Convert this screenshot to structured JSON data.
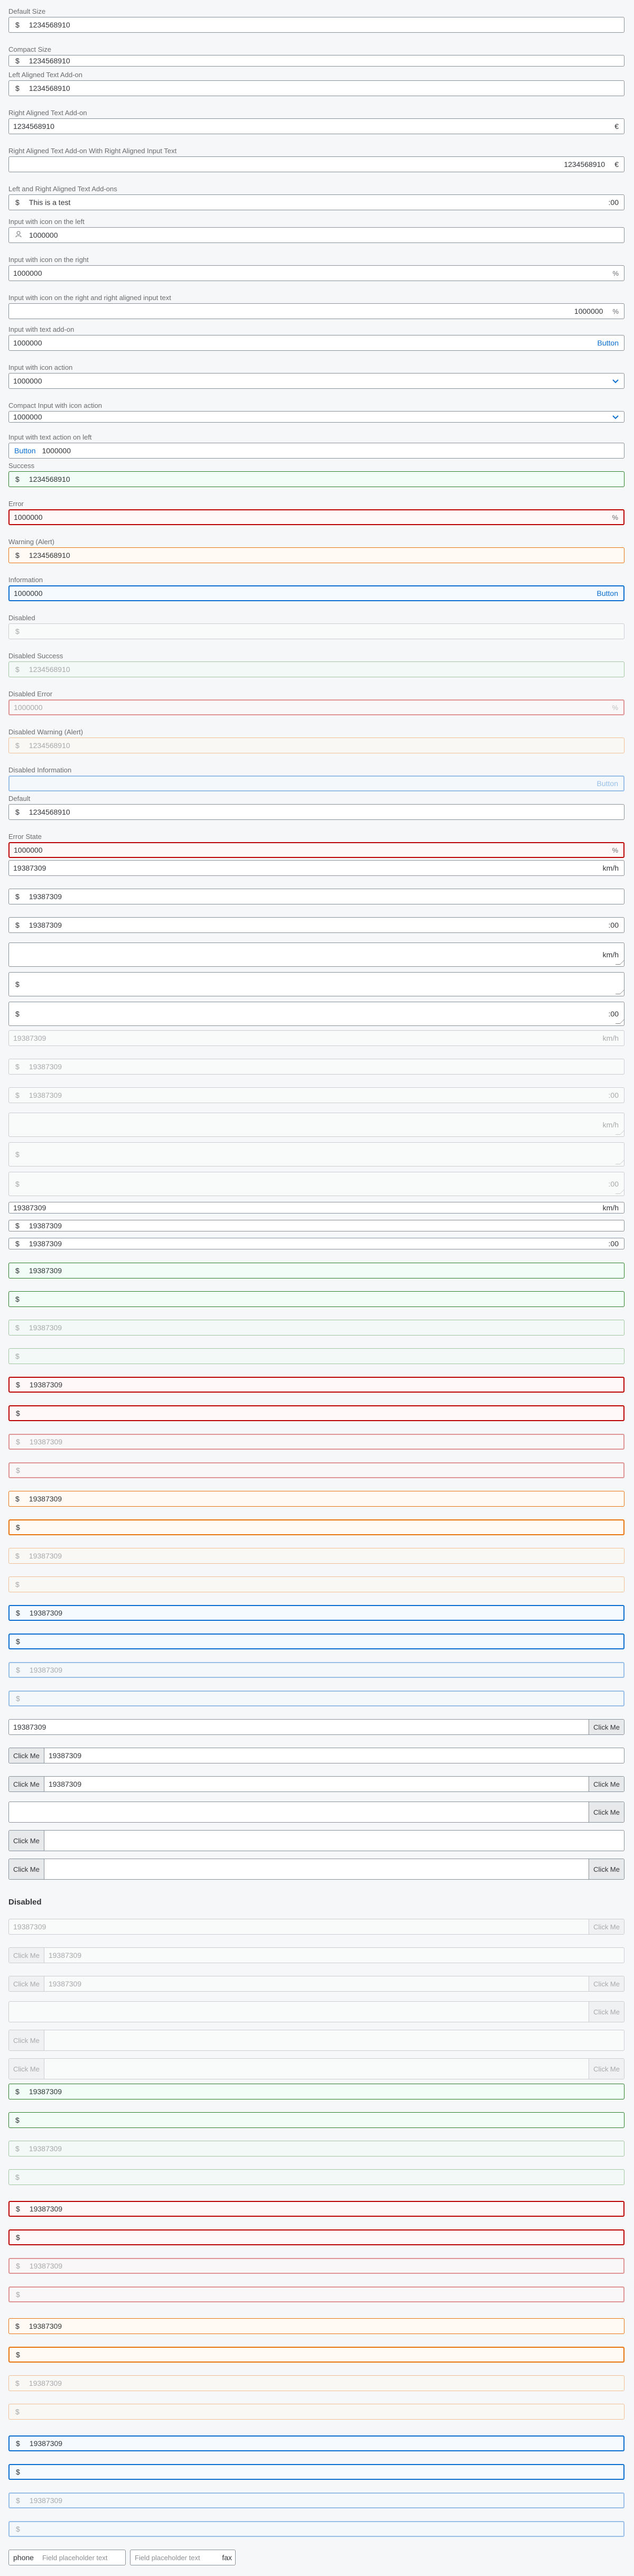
{
  "labels": {
    "default_size": "Default Size",
    "compact_size": "Compact Size",
    "left_text_addon": "Left Aligned Text Add-on",
    "right_text_addon": "Right Aligned Text Add-on",
    "right_text_addon_right_input": "Right Aligned Text Add-on With Right Aligned Input Text",
    "left_right_addons": "Left and Right Aligned Text Add-ons",
    "icon_left": "Input with icon on the left",
    "icon_right": "Input with icon on the right",
    "icon_right_right_text": "Input with icon on the right and right aligned input text",
    "text_addon": "Input with text add-on",
    "icon_action": "Input with icon action",
    "compact_icon_action": "Compact Input with icon action",
    "text_action_left": "Input with text action on left",
    "success": "Success",
    "error": "Error",
    "warning": "Warning (Alert)",
    "information": "Information",
    "disabled": "Disabled",
    "disabled_success": "Disabled Success",
    "disabled_error": "Disabled Error",
    "disabled_warning": "Disabled Warning (Alert)",
    "disabled_information": "Disabled Information",
    "default": "Default",
    "error_state": "Error State",
    "disabled_heading": "Disabled"
  },
  "values": {
    "number_long": "1234568910",
    "number_short": "1000000",
    "text_test": "This is a test",
    "number_km": "19387309",
    "placeholder_field": "Field placeholder text"
  },
  "addons": {
    "dollar": "$",
    "euro": "€",
    "time": ":00",
    "kmh": "km/h",
    "button": "Button",
    "click_me": "Click Me",
    "phone": "phone",
    "fax": "fax"
  },
  "icons": {
    "user": "user-icon",
    "percent": "percent-icon",
    "chevron": "chevron-down-icon"
  },
  "colors": {
    "success": "#2b7d2b",
    "error": "#bb0000",
    "warning": "#e9730c",
    "information": "#0a6ed1"
  }
}
